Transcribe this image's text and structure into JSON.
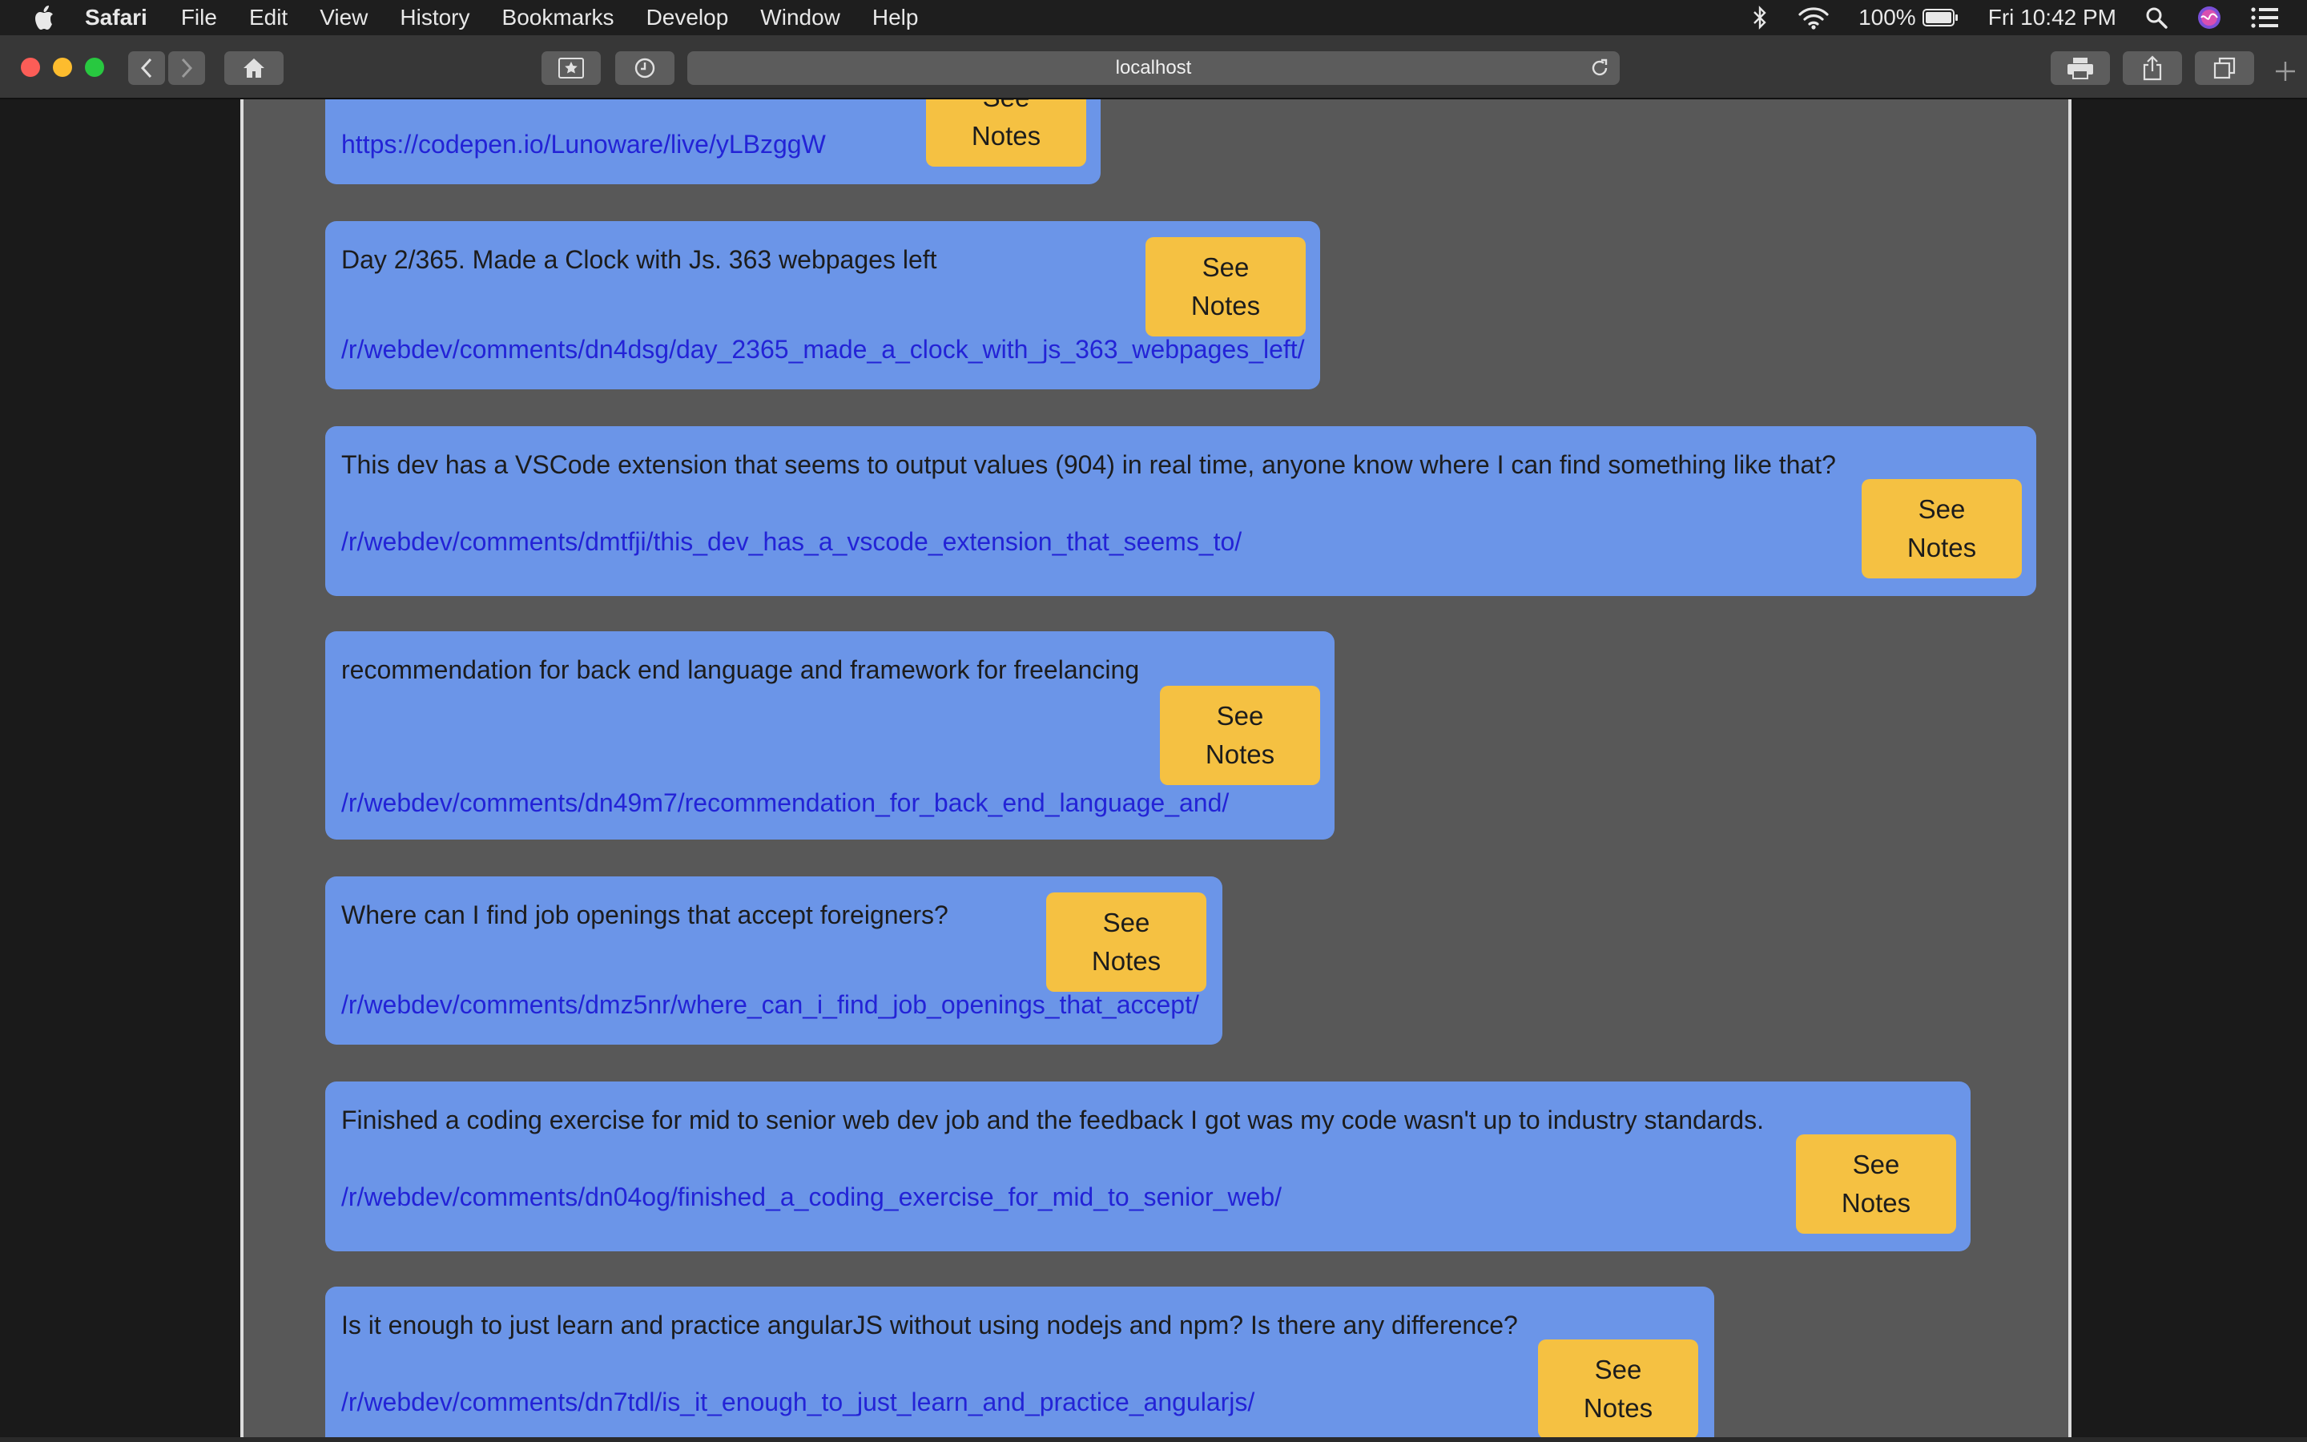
{
  "menubar": {
    "app": "Safari",
    "items": [
      "File",
      "Edit",
      "View",
      "History",
      "Bookmarks",
      "Develop",
      "Window",
      "Help"
    ],
    "battery": "100%",
    "clock": "Fri 10:42 PM"
  },
  "browser": {
    "url": "localhost"
  },
  "button_label": {
    "line1": "See",
    "line2": "Notes"
  },
  "posts": [
    {
      "title": "",
      "link": "https://codepen.io/Lunoware/live/yLBzggW"
    },
    {
      "title": "Day 2/365. Made a Clock with Js. 363 webpages left",
      "link": "/r/webdev/comments/dn4dsg/day_2365_made_a_clock_with_js_363_webpages_left/"
    },
    {
      "title": "This dev has a VSCode extension that seems to output values (904) in real time, anyone know where I can find something like that?",
      "link": "/r/webdev/comments/dmtfji/this_dev_has_a_vscode_extension_that_seems_to/"
    },
    {
      "title": "recommendation for back end language and framework for freelancing",
      "link": "/r/webdev/comments/dn49m7/recommendation_for_back_end_language_and/"
    },
    {
      "title": "Where can I find job openings that accept foreigners?",
      "link": "/r/webdev/comments/dmz5nr/where_can_i_find_job_openings_that_accept/"
    },
    {
      "title": "Finished a coding exercise for mid to senior web dev job and the feedback I got was my code wasn't up to industry standards.",
      "link": "/r/webdev/comments/dn04og/finished_a_coding_exercise_for_mid_to_senior_web/"
    },
    {
      "title": "Is it enough to just learn and practice angularJS without using nodejs and npm? Is there any difference?",
      "link": "/r/webdev/comments/dn7tdl/is_it_enough_to_just_learn_and_practice_angularjs/"
    }
  ]
}
